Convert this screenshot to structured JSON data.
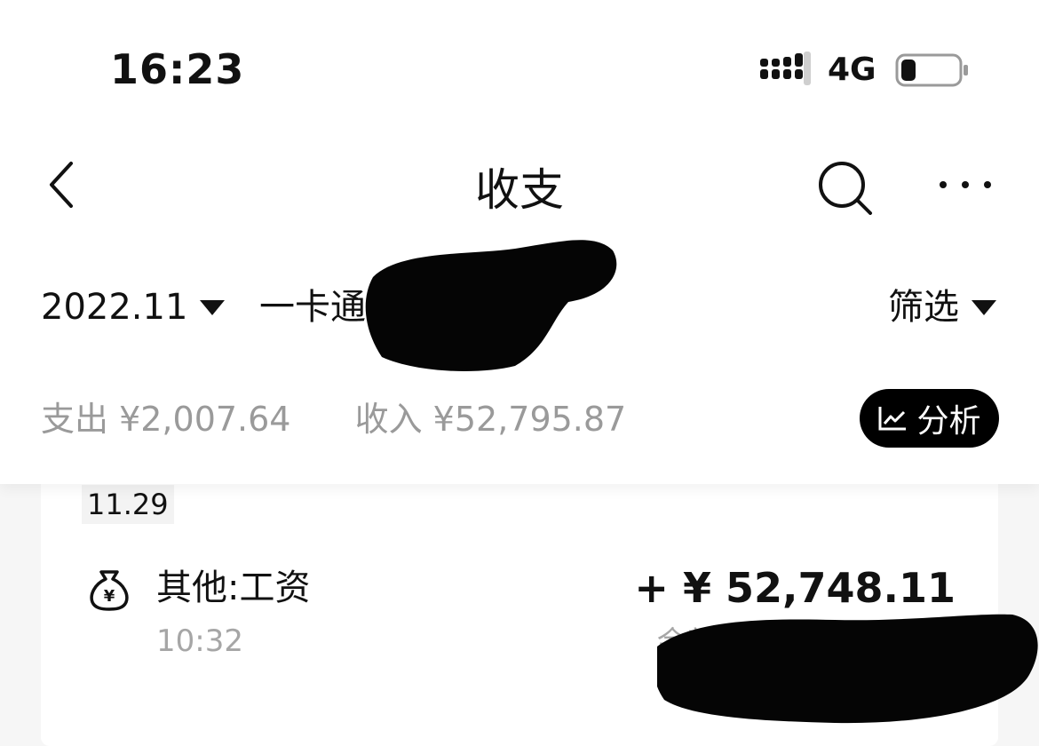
{
  "status_bar": {
    "time": "16:23",
    "network": "4G",
    "battery_level": 0.25
  },
  "header": {
    "title": "收支",
    "back_icon": "chevron-left-icon",
    "search_icon": "search-icon",
    "more_icon": "more-horizontal-icon"
  },
  "filters": {
    "month": "2022.11",
    "card": "一卡通",
    "filter_label": "筛选"
  },
  "summary": {
    "expense": "支出 ¥2,007.64",
    "income": "收入 ¥52,795.87",
    "analysis_label": "分析"
  },
  "transactions": [
    {
      "date": "11.29",
      "icon": "money-bag-icon",
      "category": "其他:工资",
      "time": "10:32",
      "amount": "+ ¥ 52,748.11",
      "balance_label": "余额"
    }
  ],
  "colors": {
    "accent": "#000000",
    "muted_text": "#9a9a9a",
    "background": "#f6f6f6"
  }
}
